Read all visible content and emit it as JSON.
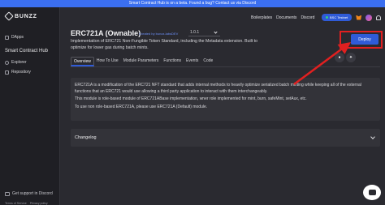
{
  "banner": {
    "text": "Smart Contract Hub is on a beta. Found a bug? Contact us via Discord"
  },
  "sidebar": {
    "logo": "BUNZZ",
    "dapps": "DApps",
    "section": "Smart Contract Hub",
    "items": [
      {
        "label": "Explorer"
      },
      {
        "label": "Repository"
      }
    ],
    "support": "Get support in Discord",
    "links": [
      "Terms of Service",
      "Privacy policy"
    ]
  },
  "topnav": {
    "links": [
      "Boilerplates",
      "Documents",
      "Discord"
    ],
    "network": "BSC Testnet"
  },
  "contract": {
    "title": "ERC721A (Ownable)",
    "created_by": "Created by bunzz-labsDEV",
    "version": "1.0.1",
    "description": "Implementation of ERC721 Non-Fungible Token Standard, including the Metadata extension. Built to optimize for lower gas during batch mints."
  },
  "actions": {
    "deploy": "Deploy"
  },
  "tabs": [
    "Overview",
    "How To Use",
    "Module Parameters",
    "Functions",
    "Events",
    "Code"
  ],
  "overview": {
    "paragraphs": [
      "ERC721A is a modification of the ERC721 NFT standard that adds internal methods to heavily optimize serialized batch minting while keeping all of the external functions that an ERC721 would use allowing a third party application to interact with them interchangeably.",
      "This module is role-based module of ERC721ABase implementation, wner role implemented for mint, burn, safeMint, setAux, etc.",
      "To use non role-based ERC721A, please use ERC721A (Default) module."
    ]
  },
  "changelog": {
    "label": "Changelog"
  },
  "colors": {
    "accent": "#2f5bd8",
    "highlight": "#e02020",
    "background": "#2a2a30"
  }
}
